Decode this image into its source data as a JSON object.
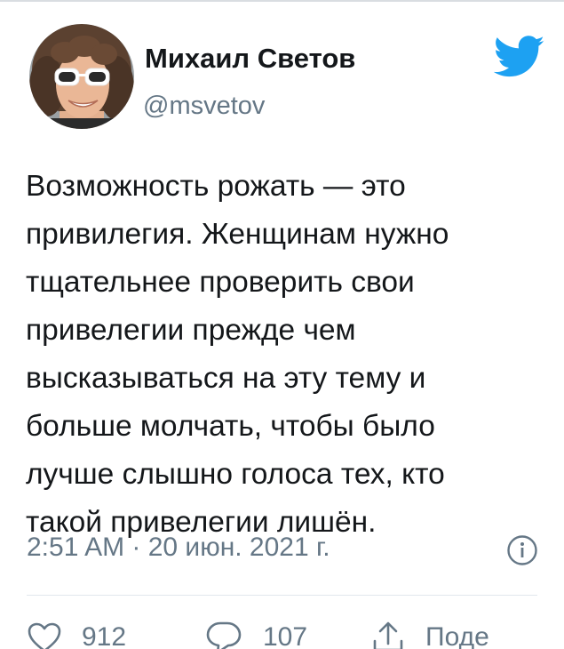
{
  "author": {
    "display_name": "Михаил Светов",
    "handle": "@msvetov"
  },
  "tweet": {
    "lines": [
      "Возможность рожать — это",
      "привилегия. Женщинам нужно",
      "тщательнее проверить свои",
      "привелегии прежде чем",
      "высказываться на эту тему и",
      "больше молчать, чтобы было",
      "лучше слышно голоса тех, кто",
      "такой привелегии лишён."
    ],
    "timestamp": "2:51 AM · 20 июн. 2021 г."
  },
  "actions": {
    "likes": "912",
    "replies": "107",
    "share_label": "Поде"
  },
  "icons": {
    "logo": "twitter-bird-icon",
    "info": "info-icon",
    "like": "heart-icon",
    "reply": "reply-bubble-icon",
    "share": "share-icon"
  },
  "colors": {
    "brand": "#1DA1F2",
    "text": "#14171A",
    "secondary_text": "#657786",
    "divider": "#E1E8ED"
  }
}
